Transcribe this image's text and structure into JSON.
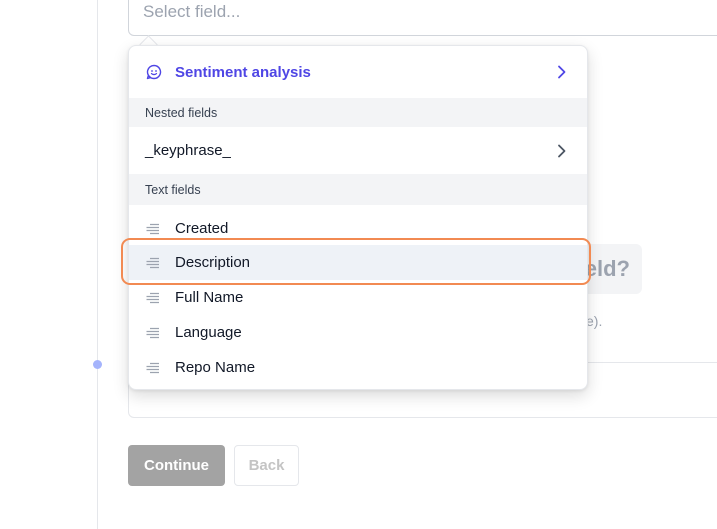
{
  "select": {
    "placeholder": "Select field..."
  },
  "dropdown": {
    "sentiment": {
      "label": "Sentiment analysis",
      "icon": "smiley-icon"
    },
    "sections": {
      "nested": "Nested fields",
      "text": "Text fields"
    },
    "nested_items": [
      {
        "label": "_keyphrase_"
      }
    ],
    "text_items": [
      {
        "label": "Created"
      },
      {
        "label": "Description",
        "selected": true
      },
      {
        "label": "Full Name"
      },
      {
        "label": "Language"
      },
      {
        "label": "Repo Name"
      }
    ]
  },
  "background": {
    "question_fragment": "eld?",
    "note_fragment": "e)."
  },
  "buttons": {
    "continue": "Continue",
    "back": "Back"
  },
  "colors": {
    "accent": "#4f46e5",
    "highlight": "#f28a52",
    "continue_bg": "#a3a3a3"
  }
}
